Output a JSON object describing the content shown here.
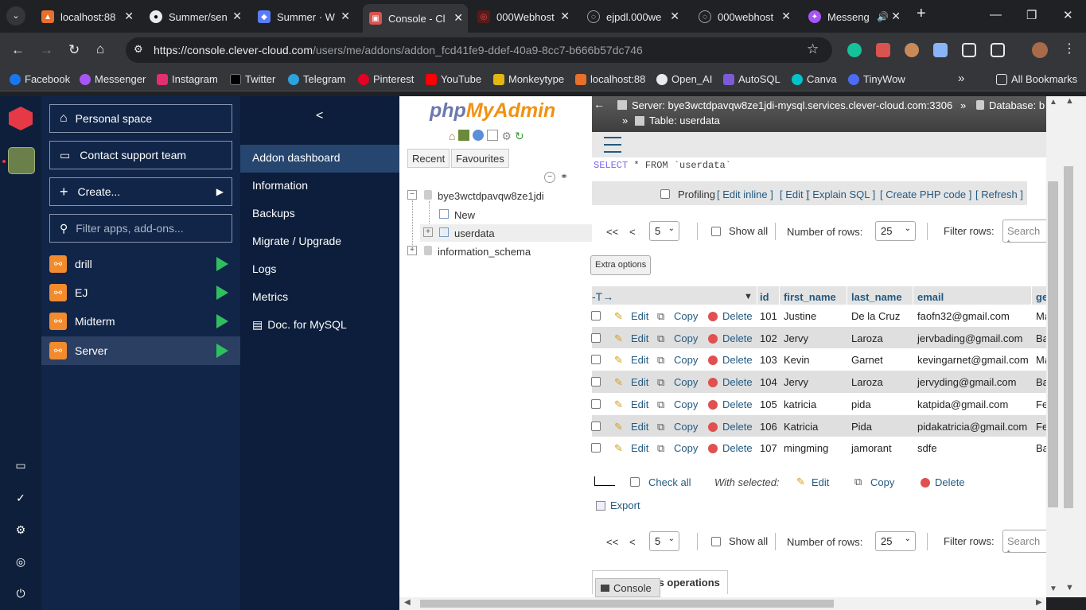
{
  "browser": {
    "tabs": [
      {
        "title": "localhost:88",
        "color": "#e8702a"
      },
      {
        "title": "Summer/sen",
        "color": "#e8eaed"
      },
      {
        "title": "Summer · W",
        "color": "#5b7cfa"
      },
      {
        "title": "Console - Cl",
        "color": "#d9534f"
      },
      {
        "title": "000Webhost",
        "color": "#d9534f"
      },
      {
        "title": "ejpdl.000we",
        "color": "#9aa0a6"
      },
      {
        "title": "000webhost",
        "color": "#9aa0a6"
      },
      {
        "title": "Messeng",
        "color": "#a855f7"
      }
    ],
    "url_host": "https://console.clever-cloud.com",
    "url_path": "/users/me/addons/addon_fcd41fe9-ddef-40a9-8cc7-b666b57dc746",
    "bookmarks": [
      "Facebook",
      "Messenger",
      "Instagram",
      "Twitter",
      "Telegram",
      "Pinterest",
      "YouTube",
      "Monkeytype",
      "localhost:88",
      "Open_AI",
      "AutoSQL",
      "Canva",
      "TinyWow"
    ],
    "all_bookmarks": "All Bookmarks"
  },
  "clever": {
    "personal_space": "Personal space",
    "contact_support": "Contact support team",
    "create": "Create...",
    "filter_placeholder": "Filter apps, add-ons...",
    "apps": [
      "drill",
      "EJ",
      "Midterm",
      "Server"
    ],
    "back": "<",
    "menu": [
      "Addon dashboard",
      "Information",
      "Backups",
      "Migrate / Upgrade",
      "Logs",
      "Metrics",
      "Doc. for MySQL"
    ]
  },
  "pma": {
    "logo_php": "php",
    "logo_myadmin": "MyAdmin",
    "recent": "Recent",
    "favourites": "Favourites",
    "db_name": "bye3wctdpavqw8ze1jdi",
    "new": "New",
    "table": "userdata",
    "schema": "information_schema",
    "breadcrumb_server": "Server: bye3wctdpavqw8ze1jdi-mysql.services.clever-cloud.com:3306",
    "breadcrumb_db": "Database: b",
    "breadcrumb_table": "Table: userdata",
    "sql_select": "SELECT",
    "sql_rest": " * FROM `userdata`",
    "profiling": "Profiling",
    "links": [
      "[ Edit inline ]",
      "[ Edit ]",
      "[ Explain SQL ]",
      "[ Create PHP code ]",
      "[ Refresh ]"
    ],
    "nav_first": "<<",
    "nav_prev": "<",
    "page_value": "5",
    "show_all": "Show all",
    "num_rows_label": "Number of rows:",
    "num_rows_value": "25",
    "filter_rows": "Filter rows:",
    "search_placeholder": "Search t",
    "extra_options": "Extra options",
    "columns": [
      "id",
      "first_name",
      "last_name",
      "email",
      "ge"
    ],
    "action_edit": "Edit",
    "action_copy": "Copy",
    "action_delete": "Delete",
    "rows": [
      {
        "id": "101",
        "first": "Justine",
        "last": "De la Cruz",
        "email": "faofn32@gmail.com",
        "g": "Ma"
      },
      {
        "id": "102",
        "first": "Jervy",
        "last": "Laroza",
        "email": "jervbading@gmail.com",
        "g": "Ba"
      },
      {
        "id": "103",
        "first": "Kevin",
        "last": "Garnet",
        "email": "kevingarnet@gmail.com",
        "g": "Ma"
      },
      {
        "id": "104",
        "first": "Jervy",
        "last": "Laroza",
        "email": "jervyding@gmail.com",
        "g": "Ba"
      },
      {
        "id": "105",
        "first": "katricia",
        "last": "pida",
        "email": "katpida@gmail.com",
        "g": "Fe"
      },
      {
        "id": "106",
        "first": "Katricia",
        "last": "Pida",
        "email": "pidakatricia@gmail.com",
        "g": "Fe"
      },
      {
        "id": "107",
        "first": "mingming",
        "last": "jamorant",
        "email": "sdfe",
        "g": "Ba"
      }
    ],
    "check_all": "Check all",
    "with_selected": "With selected:",
    "export": "Export",
    "query_results": "Query results operations",
    "console": "Console"
  },
  "colors": {
    "accent": "#235a81",
    "cc_dark": "#102548",
    "cc_selected": "#2b3f63",
    "play": "#2fbf5f"
  }
}
